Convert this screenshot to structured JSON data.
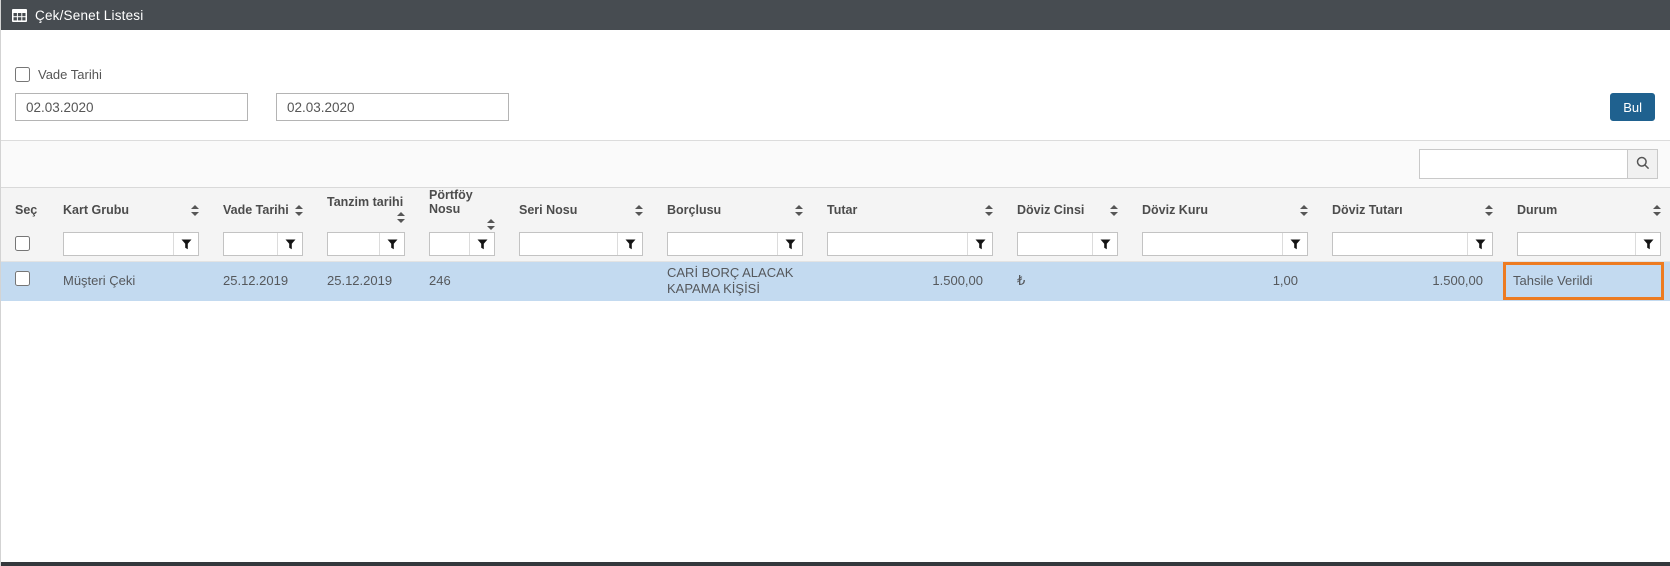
{
  "titlebar": {
    "title": "Çek/Senet Listesi"
  },
  "filter_panel": {
    "vade_tarihi_label": "Vade Tarihi",
    "vade_tarihi_checked": false,
    "date_start": "02.03.2020",
    "date_end": "02.03.2020",
    "find_button_label": "Bul"
  },
  "search": {
    "value": "",
    "placeholder": ""
  },
  "table": {
    "columns": [
      {
        "label": "Seç"
      },
      {
        "label": "Kart Grubu"
      },
      {
        "label": "Vade Tarihi"
      },
      {
        "label": "Tanzim tarihi"
      },
      {
        "label": "Pörtföy Nosu"
      },
      {
        "label": "Seri Nosu"
      },
      {
        "label": "Borçlusu"
      },
      {
        "label": "Tutar"
      },
      {
        "label": "Döviz Cinsi"
      },
      {
        "label": "Döviz Kuru"
      },
      {
        "label": "Döviz Tutarı"
      },
      {
        "label": "Durum"
      }
    ],
    "rows": [
      {
        "selected": false,
        "kart_grubu": "Müşteri Çeki",
        "vade_tarihi": "25.12.2019",
        "tanzim_tarihi": "25.12.2019",
        "portfoy_nosu": "246",
        "seri_nosu": "",
        "borclusu": "CARİ BORÇ ALACAK KAPAMA KİŞİSİ",
        "tutar": "1.500,00",
        "doviz_cinsi": "₺",
        "doviz_kuru": "1,00",
        "doviz_tutari": "1.500,00",
        "durum": "Tahsile Verildi"
      }
    ]
  },
  "colors": {
    "titlebar_bg": "#474C51",
    "find_button_bg": "#1F618F",
    "row_highlight_bg": "#C3DAF0",
    "status_highlight_border": "#ED7B21"
  }
}
